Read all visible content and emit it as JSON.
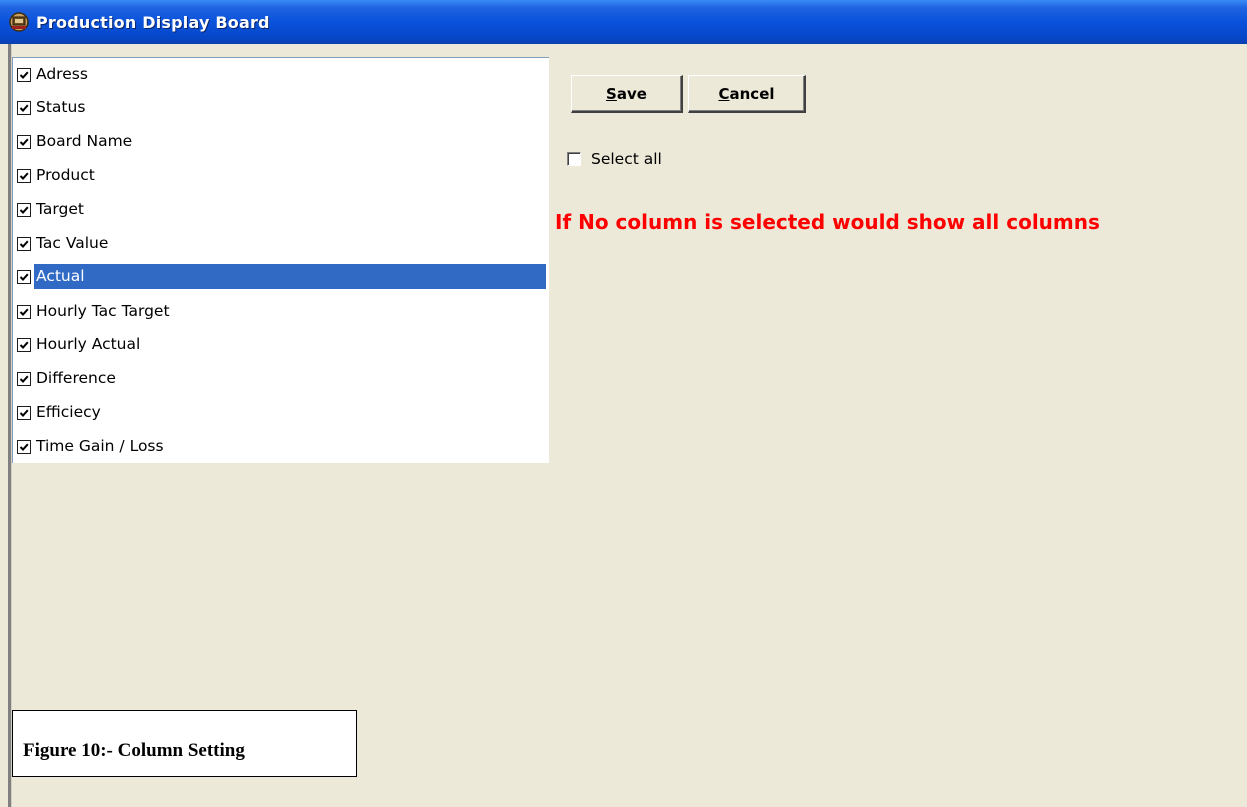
{
  "window": {
    "title": "Production Display Board",
    "icon": "app-board-icon"
  },
  "column_list": {
    "items": [
      {
        "label": "Adress",
        "checked": true,
        "selected": false
      },
      {
        "label": "Status",
        "checked": true,
        "selected": false
      },
      {
        "label": "Board Name",
        "checked": true,
        "selected": false
      },
      {
        "label": "Product",
        "checked": true,
        "selected": false
      },
      {
        "label": "Target",
        "checked": true,
        "selected": false
      },
      {
        "label": "Tac Value",
        "checked": true,
        "selected": false
      },
      {
        "label": "Actual",
        "checked": true,
        "selected": true
      },
      {
        "label": "Hourly Tac Target",
        "checked": true,
        "selected": false
      },
      {
        "label": "Hourly Actual",
        "checked": true,
        "selected": false
      },
      {
        "label": "Difference",
        "checked": true,
        "selected": false
      },
      {
        "label": "Efficiecy",
        "checked": true,
        "selected": false
      },
      {
        "label": "Time Gain / Loss",
        "checked": true,
        "selected": false
      }
    ]
  },
  "buttons": {
    "save": {
      "accel": "S",
      "rest": "ave"
    },
    "cancel": {
      "accel": "C",
      "rest": "ancel"
    }
  },
  "select_all": {
    "label": "Select all",
    "checked": false
  },
  "warning_text": "If No column is selected would show all columns",
  "caption": "Figure 10:- Column Setting",
  "colors": {
    "titlebar": "#0a52dc",
    "selection": "#316ac5",
    "warning": "#ff0000",
    "window_bg": "#ece9d8"
  }
}
